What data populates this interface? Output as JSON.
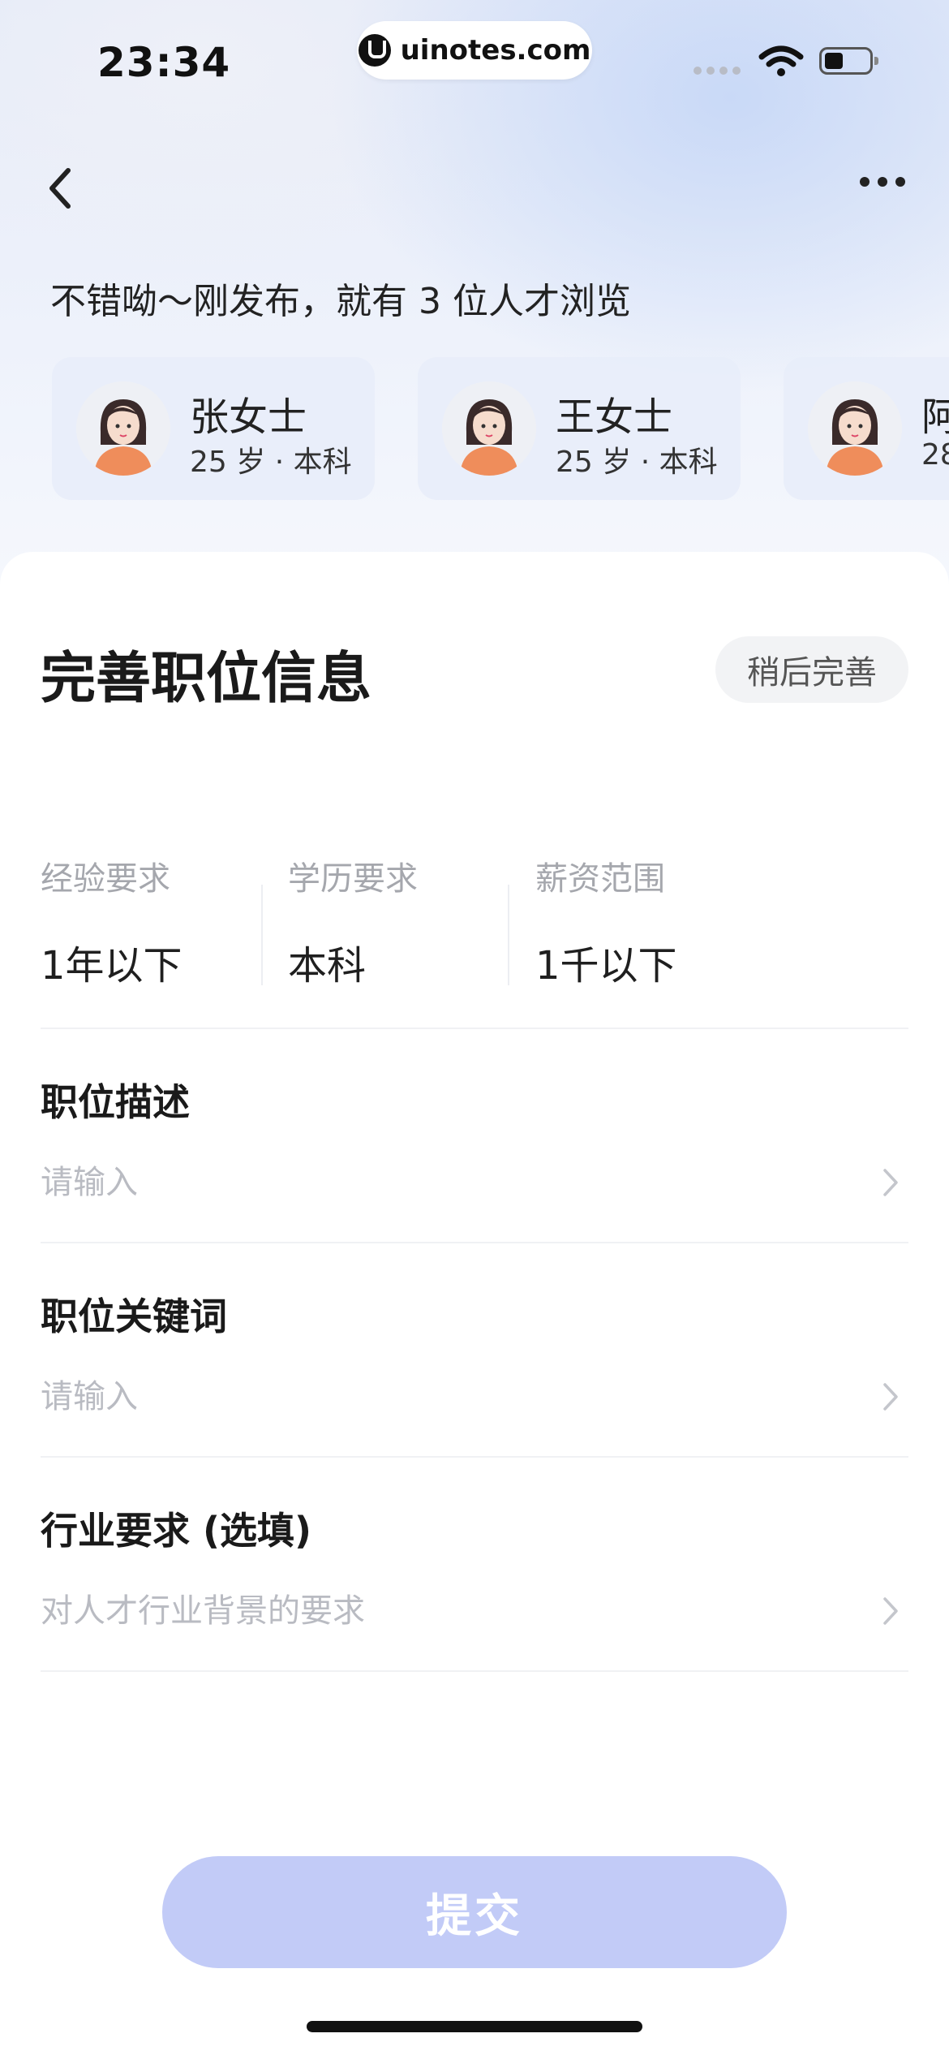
{
  "status_bar": {
    "time": "23:34",
    "url": "uinotes.com"
  },
  "header": {
    "back_icon": "chevron-left-icon",
    "more_icon": "more-dots-icon"
  },
  "notice": "不错呦～刚发布，就有 3 位人才浏览",
  "viewers": [
    {
      "name": "张女士",
      "meta": "25 岁 · 本科"
    },
    {
      "name": "王女士",
      "meta": "25 岁 · 本科"
    },
    {
      "name": "阿",
      "meta": "28"
    }
  ],
  "form": {
    "title": "完善职位信息",
    "later_label": "稍后完善",
    "requirements": [
      {
        "label": "经验要求",
        "value": "1年以下"
      },
      {
        "label": "学历要求",
        "value": "本科"
      },
      {
        "label": "薪资范围",
        "value": "1千以下"
      }
    ],
    "fields": [
      {
        "title": "职位描述",
        "placeholder": "请输入"
      },
      {
        "title": "职位关键词",
        "placeholder": "请输入"
      },
      {
        "title": "行业要求 (选填)",
        "placeholder": "对人才行业背景的要求"
      }
    ],
    "submit_label": "提交"
  },
  "colors": {
    "accent_disabled": "#c2cbf7",
    "avatar_shirt": "#ef8d5b"
  }
}
